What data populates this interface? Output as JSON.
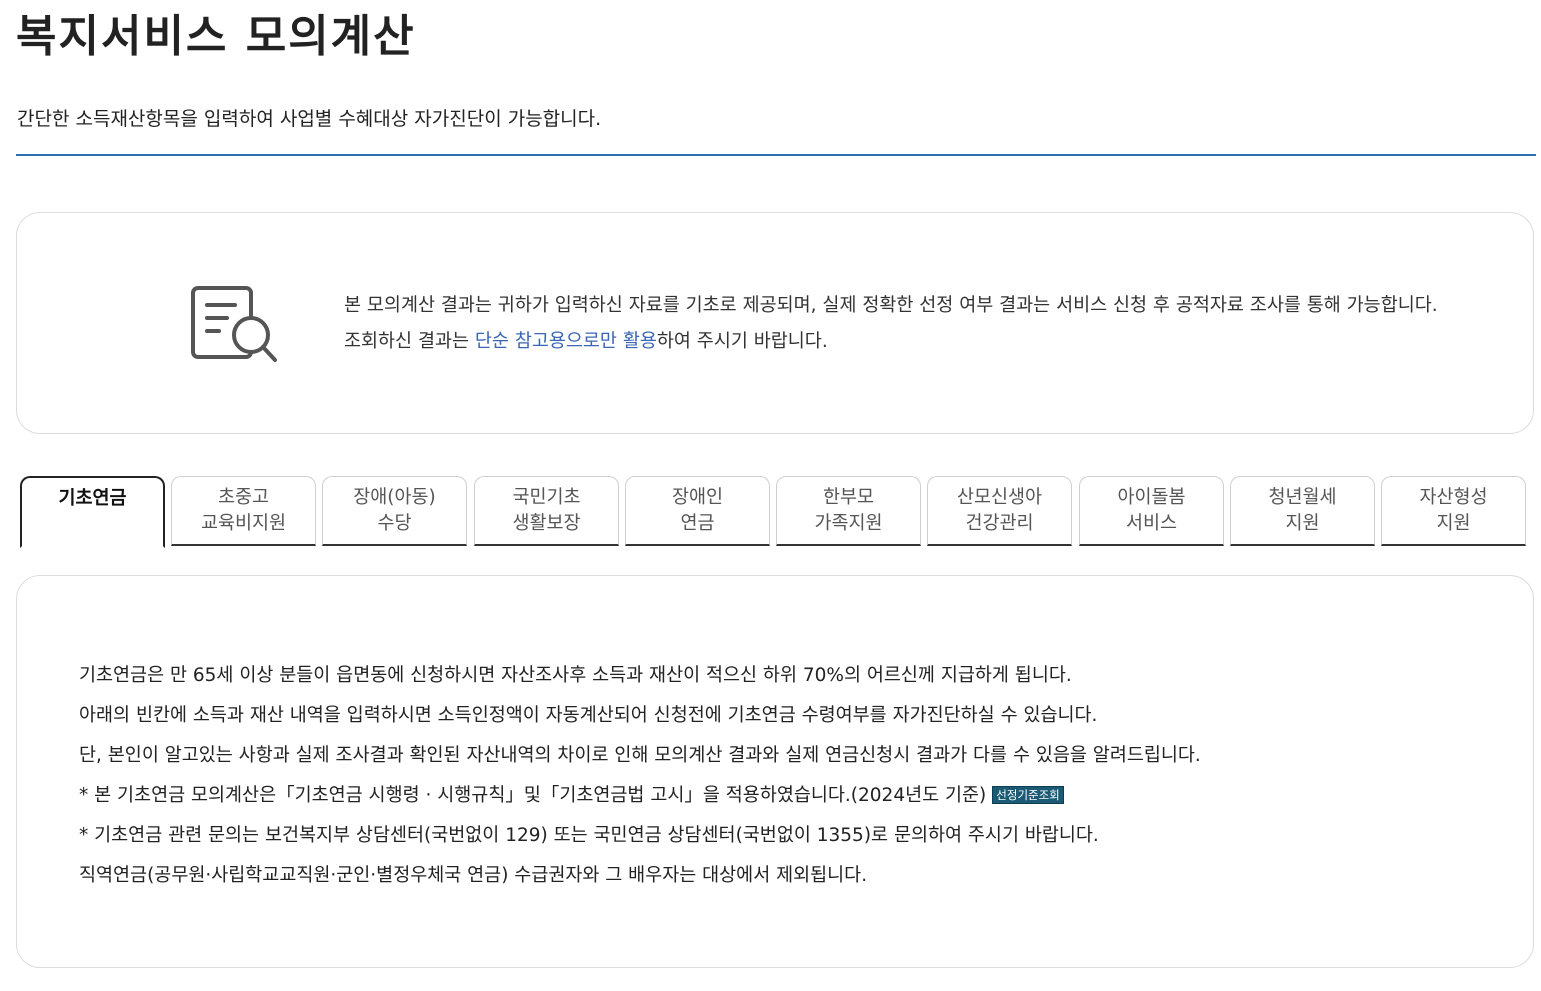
{
  "header": {
    "title": "복지서비스 모의계산",
    "subtitle": "간단한 소득재산항목을 입력하여 사업별 수혜대상 자가진단이 가능합니다."
  },
  "notice": {
    "icon": "document-search-icon",
    "text_before": "본 모의계산 결과는 귀하가 입력하신 자료를 기초로 제공되며, 실제 정확한 선정 여부 결과는 서비스 신청 후 공적자료 조사를 통해 가능합니다. 조회하신 결과는 ",
    "text_highlight": "단순 참고용으로만 활용",
    "text_after": "하여 주시기 바랍니다.",
    "highlight_color": "#3a66b5"
  },
  "tabs": [
    {
      "line1": "기초연금",
      "line2": "",
      "active": true
    },
    {
      "line1": "초중고",
      "line2": "교육비지원",
      "active": false
    },
    {
      "line1": "장애(아동)",
      "line2": "수당",
      "active": false
    },
    {
      "line1": "국민기초",
      "line2": "생활보장",
      "active": false
    },
    {
      "line1": "장애인",
      "line2": "연금",
      "active": false
    },
    {
      "line1": "한부모",
      "line2": "가족지원",
      "active": false
    },
    {
      "line1": "산모신생아",
      "line2": "건강관리",
      "active": false
    },
    {
      "line1": "아이돌봄",
      "line2": "서비스",
      "active": false
    },
    {
      "line1": "청년월세",
      "line2": "지원",
      "active": false
    },
    {
      "line1": "자산형성",
      "line2": "지원",
      "active": false
    }
  ],
  "content": {
    "lines": [
      "기초연금은 만 65세 이상 분들이 읍면동에 신청하시면 자산조사후 소득과 재산이 적으신 하위 70%의 어르신께 지급하게 됩니다.",
      "아래의 빈칸에 소득과 재산 내역을 입력하시면 소득인정액이 자동계산되어 신청전에 기초연금 수령여부를 자가진단하실 수 있습니다.",
      "단, 본인이 알고있는 사항과 실제 조사결과 확인된 자산내역의 차이로 인해 모의계산 결과와 실제 연금신청시 결과가 다를 수 있음을 알려드립니다.",
      "* 본 기초연금 모의계산은「기초연금 시행령 · 시행규칙」및「기초연금법 고시」을 적용하였습니다.(2024년도 기준)",
      "* 기초연금 관련 문의는 보건복지부 상담센터(국번없이 129) 또는 국민연금 상담센터(국번없이 1355)로 문의하여 주시기 바랍니다.",
      "직역연금(공무원·사립학교교직원·군인·별정우체국 연금) 수급권자와 그 배우자는 대상에서 제외됩니다."
    ],
    "badge_label": "선정기준조회",
    "badge_color": "#1b5a75"
  }
}
